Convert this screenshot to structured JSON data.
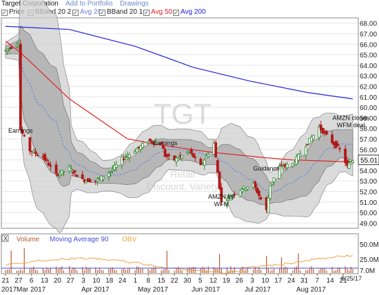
{
  "header": {
    "title": "Target Corporation",
    "add_portfolio": "Add to Portfolio",
    "drawings": "Drawings"
  },
  "legend": {
    "price": "Price",
    "bb20_2": "BBand 20 2",
    "avg20": "Avg 20",
    "bb20_1": "BBand 20 1",
    "avg50": "Avg 50",
    "avg200": "Avg 200"
  },
  "watermark": {
    "symbol": "TGT",
    "name": "Target Corporation",
    "sector": "Retail",
    "industry": "Discount, Variety"
  },
  "annotations": [
    {
      "text": "Earnings",
      "x": "2017-03-01",
      "y": 57.6
    },
    {
      "text": "Earnings",
      "x": "2017-05-17",
      "y": 56.4
    },
    {
      "text": "AMZN for",
      "x": "2017-06-16",
      "y": 51.3
    },
    {
      "text": "WFM",
      "x": "2017-06-16",
      "y": 50.6
    },
    {
      "text": "Guidance",
      "x": "2017-07-10",
      "y": 54.0
    },
    {
      "text": "AMZN closes",
      "x": "2017-08-24",
      "y": 58.8
    },
    {
      "text": "WFM deal",
      "x": "2017-08-24",
      "y": 58.1
    }
  ],
  "indicator_panel": {
    "close_label": "X",
    "volume_label": "Volume",
    "ma_label": "Moving Average 90",
    "obv_label": "OBV",
    "yticks": [
      "50.0M",
      "25.0M",
      "7.0M"
    ]
  },
  "xaxis": {
    "ticks": [
      "21",
      "27",
      "6",
      "13",
      "20",
      "27",
      "3",
      "10",
      "18",
      "24",
      "1",
      "8",
      "15",
      "22",
      "30",
      "5",
      "12",
      "19",
      "26",
      "3",
      "10",
      "17",
      "24",
      "31",
      "7",
      "14",
      "21"
    ],
    "months": [
      "2017",
      "Mar 2017",
      "Apr 2017",
      "May 2017",
      "Jun 2017",
      "Jul 2017",
      "Aug 2017"
    ],
    "last_date": "8/25/17"
  },
  "colors": {
    "up": "#2e8b2e",
    "down": "#b01818",
    "avg50": "#e02020",
    "avg200": "#2020e0",
    "avg20": "#6a80e0",
    "band_outer": "#cfcfcf",
    "band_inner": "#a9a9a9",
    "volume": "#b85a2a",
    "ma_volume": "#4a4ad8",
    "obv": "#f0a040",
    "last_price_box": "#ffffff"
  },
  "chart_data": {
    "type": "candlestick",
    "x_range": [
      "2017-02-21",
      "2017-08-25"
    ],
    "ylim": [
      48.5,
      68.5
    ],
    "yticks": [
      49,
      50,
      51,
      52,
      53,
      54,
      55,
      56,
      57,
      58,
      59,
      60,
      61,
      62,
      63,
      64,
      65,
      66,
      67,
      68
    ],
    "last_price": "55.01",
    "closes": [
      [
        "2017-02-21",
        65.4
      ],
      [
        "2017-02-28",
        66.2
      ],
      [
        "2017-03-01",
        57.9
      ],
      [
        "2017-03-06",
        55.9
      ],
      [
        "2017-03-13",
        55.3
      ],
      [
        "2017-03-20",
        53.6
      ],
      [
        "2017-03-27",
        54.2
      ],
      [
        "2017-04-03",
        53.1
      ],
      [
        "2017-04-10",
        53.0
      ],
      [
        "2017-04-18",
        53.9
      ],
      [
        "2017-04-24",
        55.1
      ],
      [
        "2017-05-01",
        55.9
      ],
      [
        "2017-05-08",
        56.8
      ],
      [
        "2017-05-15",
        56.6
      ],
      [
        "2017-05-17",
        55.4
      ],
      [
        "2017-05-22",
        55.0
      ],
      [
        "2017-05-30",
        55.8
      ],
      [
        "2017-06-05",
        54.4
      ],
      [
        "2017-06-12",
        56.6
      ],
      [
        "2017-06-16",
        51.0
      ],
      [
        "2017-06-19",
        51.3
      ],
      [
        "2017-06-26",
        52.2
      ],
      [
        "2017-07-03",
        52.7
      ],
      [
        "2017-07-10",
        50.2
      ],
      [
        "2017-07-12",
        52.6
      ],
      [
        "2017-07-17",
        54.3
      ],
      [
        "2017-07-24",
        54.6
      ],
      [
        "2017-07-31",
        56.4
      ],
      [
        "2017-08-07",
        58.1
      ],
      [
        "2017-08-14",
        56.7
      ],
      [
        "2017-08-18",
        56.0
      ],
      [
        "2017-08-22",
        54.4
      ],
      [
        "2017-08-25",
        55.0
      ]
    ],
    "series": [
      {
        "name": "Avg 50",
        "points": [
          [
            "2017-02-21",
            66.3
          ],
          [
            "2017-03-01",
            65.2
          ],
          [
            "2017-03-27",
            60.8
          ],
          [
            "2017-04-27",
            57.0
          ],
          [
            "2017-05-15",
            56.4
          ],
          [
            "2017-06-12",
            55.7
          ],
          [
            "2017-07-10",
            55.2
          ],
          [
            "2017-07-24",
            55.0
          ],
          [
            "2017-08-25",
            54.8
          ]
        ]
      },
      {
        "name": "Avg 200",
        "points": [
          [
            "2017-02-21",
            67.7
          ],
          [
            "2017-03-27",
            67.4
          ],
          [
            "2017-05-01",
            65.8
          ],
          [
            "2017-06-01",
            63.8
          ],
          [
            "2017-07-01",
            62.5
          ],
          [
            "2017-08-01",
            61.4
          ],
          [
            "2017-08-25",
            60.8
          ]
        ]
      }
    ]
  }
}
